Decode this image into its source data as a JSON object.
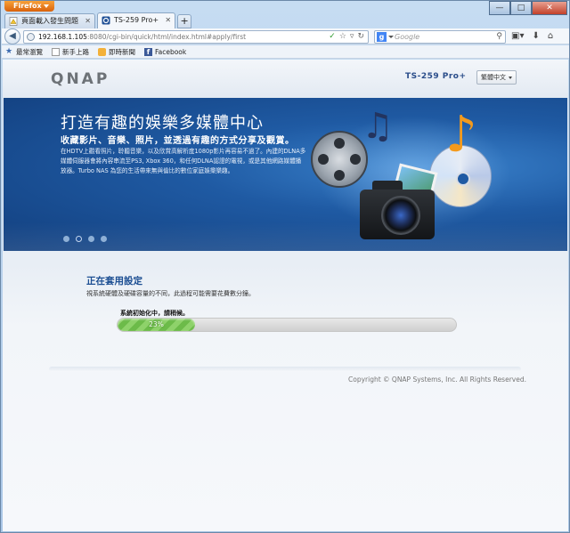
{
  "browser": {
    "app_button": "Firefox",
    "tabs": [
      {
        "label": "頁面載入發生問題",
        "active": false
      },
      {
        "label": "TS-259 Pro+",
        "active": true
      }
    ],
    "new_tab": "+",
    "url": {
      "host": "192.168.1.105",
      "path": ":8080/cgi-bin/quick/html/index.html#apply/first"
    },
    "search_placeholder": "Google",
    "bookmarks": [
      "最常瀏覽",
      "新手上路",
      "即時新聞",
      "Facebook"
    ]
  },
  "page": {
    "logo": "QNAP",
    "model": "TS-259 Pro+",
    "language": "繁體中文",
    "banner": {
      "title": "打造有趣的娛樂多媒體中心",
      "subtitle": "收藏影片、音樂、照片，並透過有趣的方式分享及觀賞。",
      "description": "在HDTV上觀看照片，聆聽音樂，以及欣賞高解析度1080p影片再容易不過了。內建的DLNA多媒體伺服器會將內容串流至PS3, Xbox 360，和任何DLNA認證的電視，或是其他網路媒體播放器。Turbo NAS 為您的生活帶來無與倫比的數位家庭娛樂樂趣。",
      "slides": 4,
      "active_slide": 2
    },
    "apply": {
      "title": "正在套用設定",
      "description": "視系統硬體及硬碟容量的不同，此過程可能需要花費數分鐘。",
      "status": "系統初始化中，請稍候。",
      "progress_text": "23%",
      "progress_value": 0.23
    },
    "copyright": "Copyright © QNAP Systems, Inc. All Rights Reserved."
  },
  "colors": {
    "accent": "#1d4f93",
    "progress": "#8ed26a",
    "banner": "#1f5aa3"
  }
}
